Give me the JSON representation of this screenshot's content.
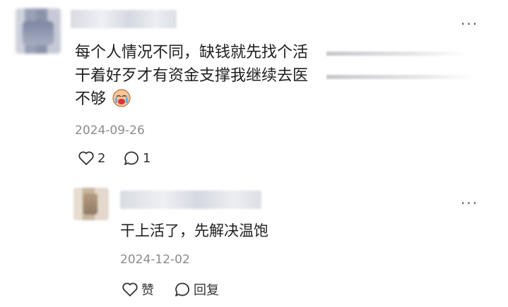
{
  "comment": {
    "text_lines": [
      "每个人情况不同，缺钱就先找个活",
      "干着好歹才有资金支撑我继续去医",
      "不够"
    ],
    "emoji": "crying-face",
    "date": "2024-09-26",
    "likes": "2",
    "replies": "1"
  },
  "reply": {
    "text": "干上活了，先解决温饱",
    "date": "2024-12-02",
    "like_label": "赞",
    "reply_label": "回复"
  },
  "menu": {
    "more": "···"
  }
}
